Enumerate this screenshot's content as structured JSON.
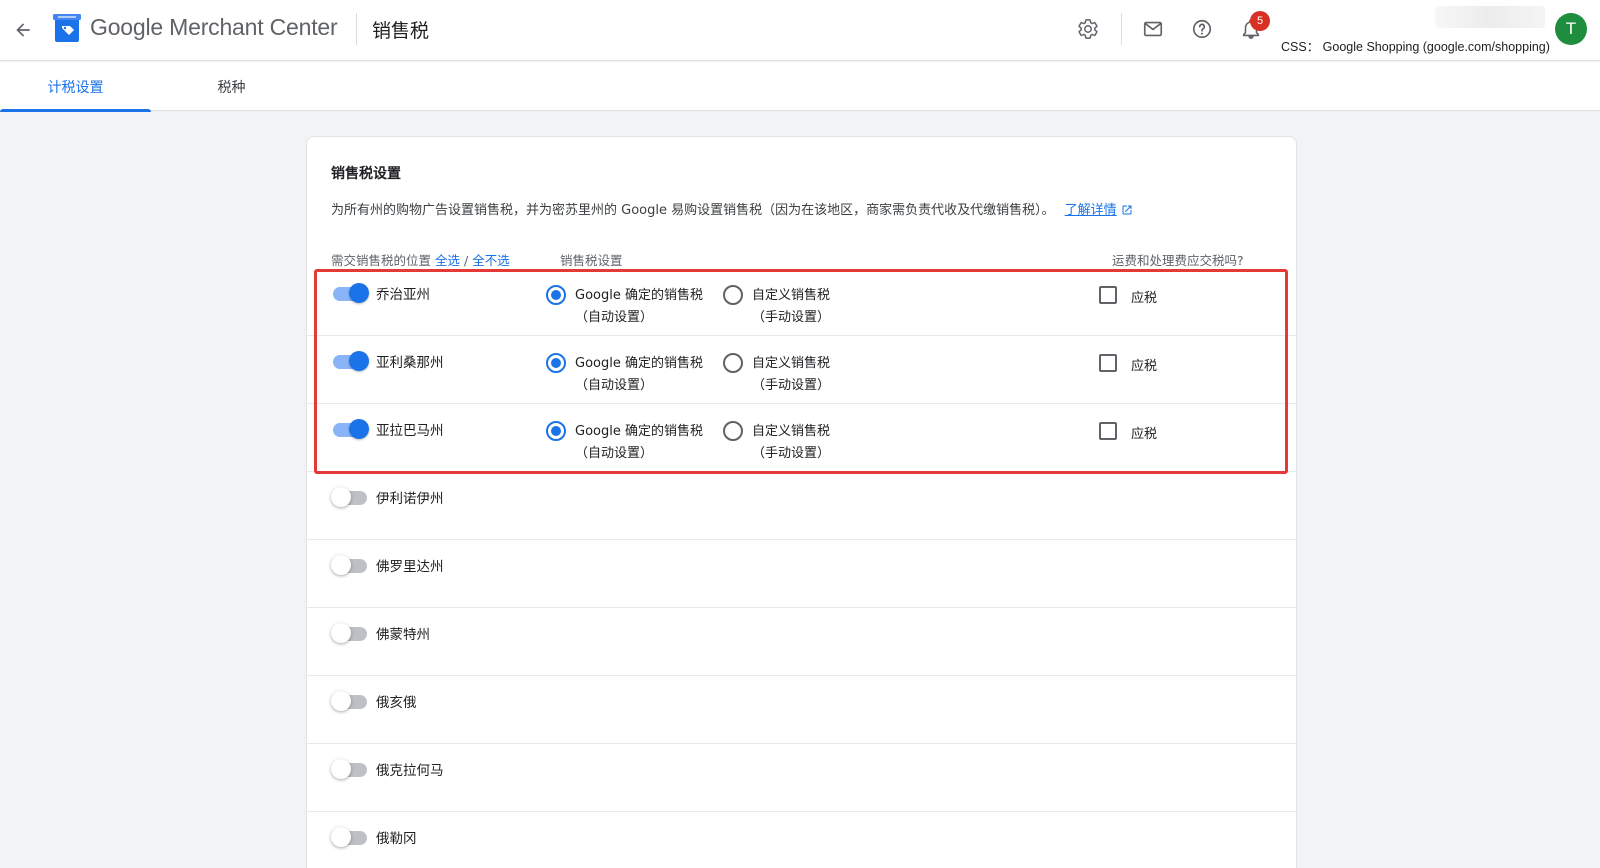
{
  "header": {
    "app_name": "Google Merchant Center",
    "page_title": "销售税",
    "notification_count": "5",
    "account_css": "CSS：  Google Shopping (google.com/shopping)",
    "avatar_initial": "T",
    "icons": [
      "back-arrow-icon",
      "merchant-center-logo",
      "settings-icon",
      "mail-icon",
      "help-icon",
      "notifications-icon"
    ]
  },
  "tabs": [
    {
      "label": "计税设置",
      "active": true
    },
    {
      "label": "税种",
      "active": false
    }
  ],
  "card": {
    "title": "销售税设置",
    "description": "为所有州的购物广告设置销售税，并为密苏里州的 Google 易购设置销售税（因为在该地区，商家需负责代收及代缴销售税）。",
    "learn_more": "了解详情",
    "columns": {
      "location": "需交销售税的位置",
      "select_all": "全选",
      "slash": " / ",
      "deselect_all": "全不选",
      "tax_setting": "销售税设置",
      "shipping_taxable": "运费和处理费应交税吗?"
    },
    "option_labels": {
      "google_line1": "Google 确定的销售税",
      "google_line2": "（自动设置）",
      "custom_line1": "自定义销售税",
      "custom_line2": "（手动设置）",
      "taxable": "应税"
    },
    "states": [
      {
        "name": "乔治亚州",
        "enabled": true,
        "tax_mode": "google",
        "shipping_taxable": false
      },
      {
        "name": "亚利桑那州",
        "enabled": true,
        "tax_mode": "google",
        "shipping_taxable": false
      },
      {
        "name": "亚拉巴马州",
        "enabled": true,
        "tax_mode": "google",
        "shipping_taxable": false
      },
      {
        "name": "伊利诺伊州",
        "enabled": false
      },
      {
        "name": "佛罗里达州",
        "enabled": false
      },
      {
        "name": "佛蒙特州",
        "enabled": false
      },
      {
        "name": "俄亥俄",
        "enabled": false
      },
      {
        "name": "俄克拉何马",
        "enabled": false
      },
      {
        "name": "俄勒冈",
        "enabled": false
      }
    ]
  },
  "colors": {
    "accent": "#1a73e8",
    "highlight_border": "#e53935",
    "avatar_bg": "#1e8e3e",
    "badge_bg": "#d93025"
  }
}
